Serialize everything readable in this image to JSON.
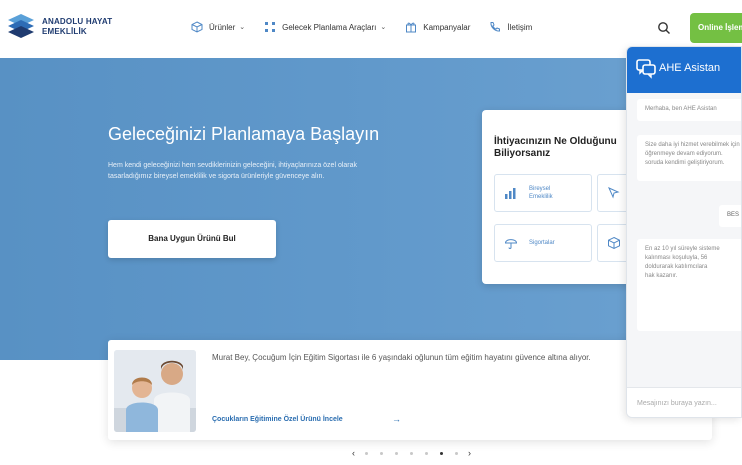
{
  "brand": {
    "line1": "ANADOLU HAYAT",
    "line2": "EMEKLİLİK"
  },
  "nav": {
    "items": [
      {
        "label": "Ürünler",
        "icon": "box-icon",
        "has_dropdown": true
      },
      {
        "label": "Gelecek Planlama Araçları",
        "icon": "grid-icon",
        "has_dropdown": true
      },
      {
        "label": "Kampanyalar",
        "icon": "gift-icon",
        "has_dropdown": false
      },
      {
        "label": "İletişim",
        "icon": "phone-icon",
        "has_dropdown": false
      }
    ],
    "online_label": "Online İşlemler"
  },
  "hero": {
    "title": "Geleceğinizi Planlamaya Başlayın",
    "description": "Hem kendi geleceğinizi hem sevdiklerinizin geleceğini, ihtiyaçlarınıza özel olarak tasarladığımız bireysel emeklilik ve sigorta ürünleriyle güvenceye alın.",
    "cta_label": "Bana Uygun Ürünü Bul"
  },
  "needs": {
    "title": "İhtiyacınızın Ne Olduğunu Biliyorsanız",
    "cards": [
      {
        "label": "Bireysel Emeklilik",
        "icon": "chart-icon"
      },
      {
        "label": "",
        "icon": "cursor-icon"
      },
      {
        "label": "Sigortalar",
        "icon": "umbrella-icon"
      },
      {
        "label": "",
        "icon": "cube-icon"
      }
    ]
  },
  "story": {
    "text": "Murat Bey, Çocuğum İçin Eğitim Sigortası ile 6 yaşındaki oğlunun tüm eğitim hayatını güvence altına alıyor.",
    "link_label": "Çocukların Eğitimine Özel Ürünü İncele",
    "arrow": "→"
  },
  "carousel": {
    "prev": "‹",
    "next": "›",
    "dot_count": 7,
    "active_index": 5
  },
  "chat": {
    "title": "AHE Asistan",
    "messages": [
      {
        "from": "bot",
        "text": "Merhaba, ben AHE Asistan"
      },
      {
        "from": "bot",
        "text": "Size daha iyi hizmet verebilmek için\nöğrenmeye devam ediyorum.\nsoruda kendimi geliştiriyorum."
      },
      {
        "from": "user",
        "text": "BES"
      },
      {
        "from": "bot",
        "text": "En az 10 yıl süreyle sisteme\nkalınması koşuluyla, 56\ndoldurarak katılımcılara\nhak kazanır."
      }
    ],
    "input_placeholder": "Mesajınızı buraya yazın..."
  },
  "colors": {
    "brand_blue": "#1f3b70",
    "hero_blue": "#5b94c7",
    "accent_green": "#74c043",
    "chat_blue": "#1d6fd0",
    "link_blue": "#2a6db0"
  }
}
